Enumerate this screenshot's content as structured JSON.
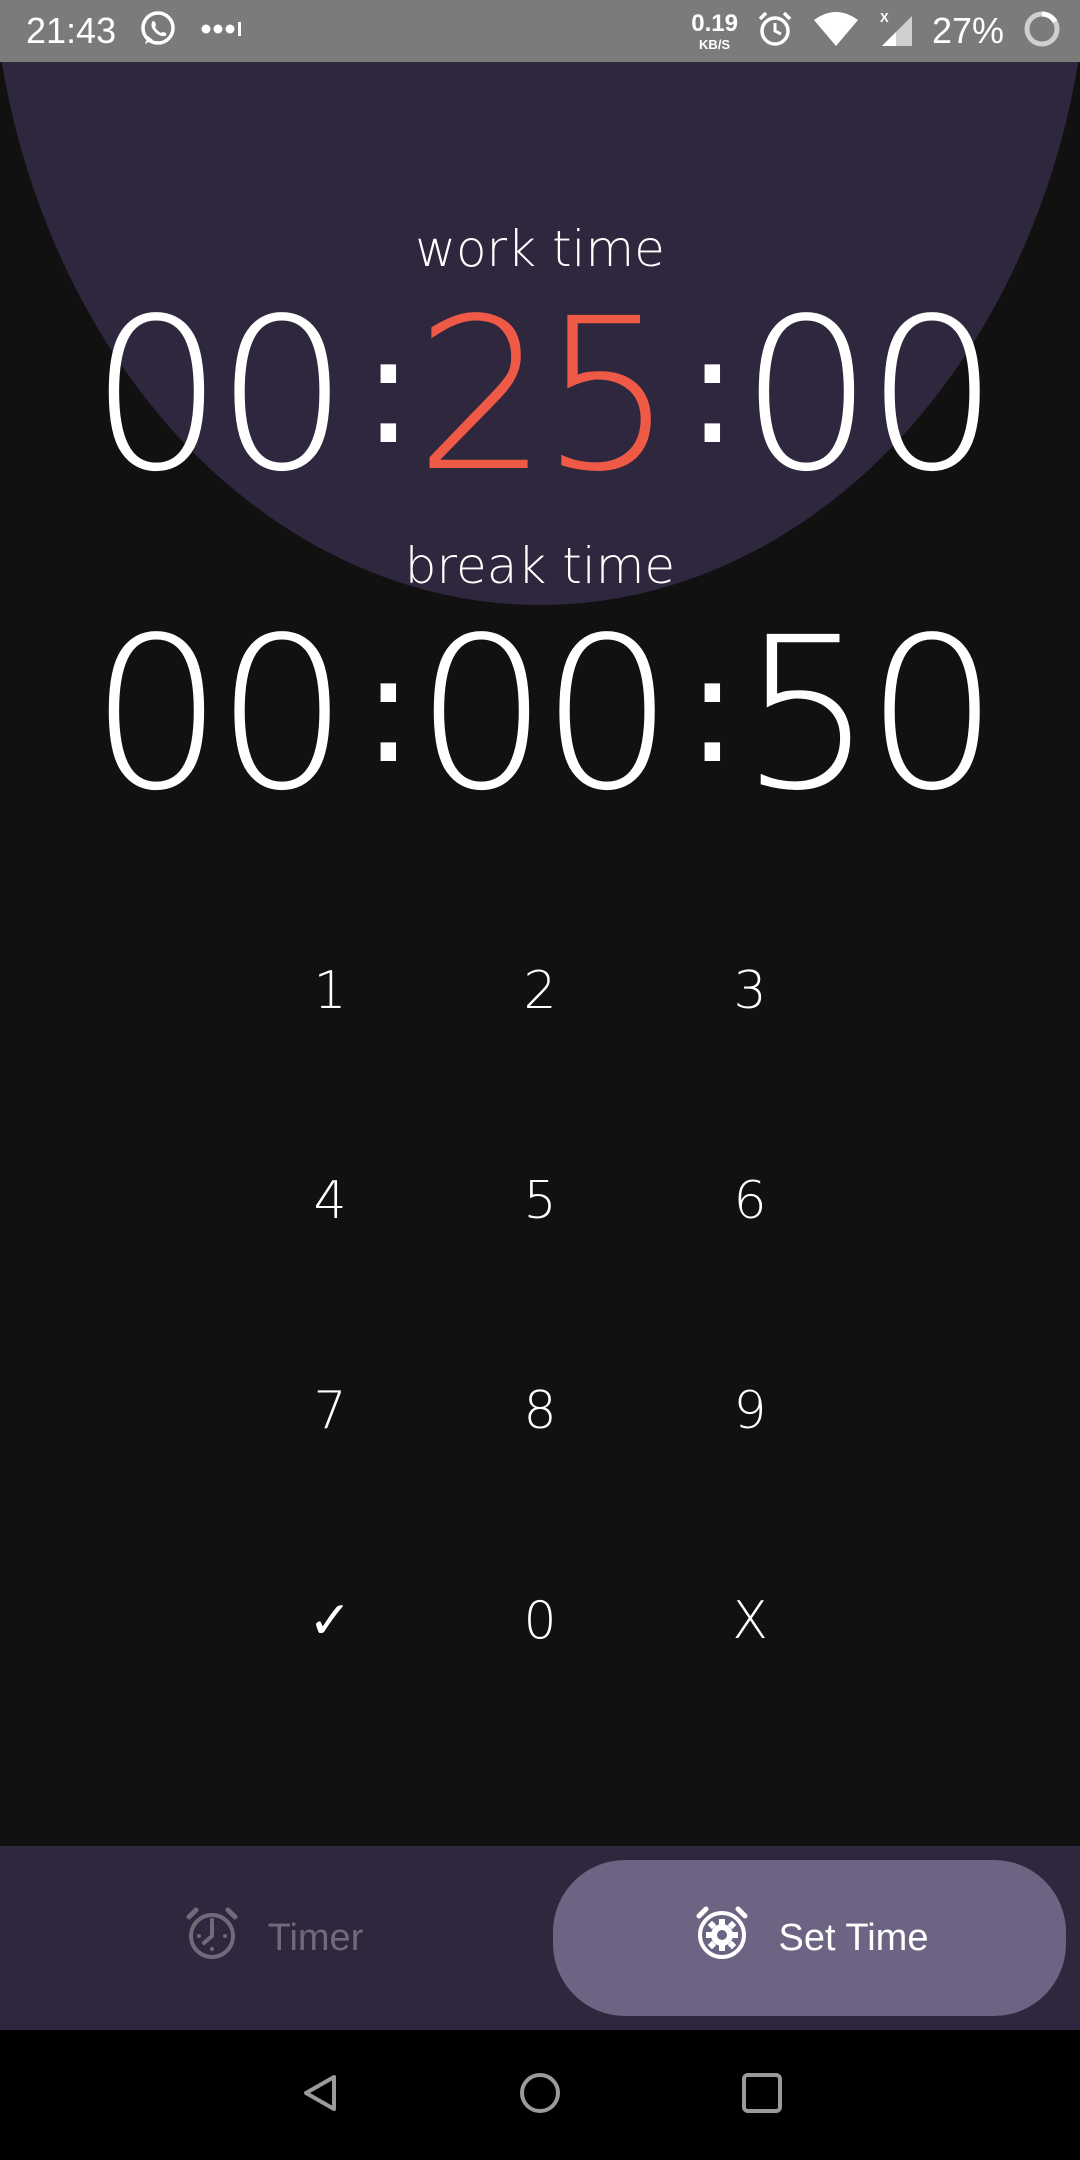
{
  "status_bar": {
    "time": "21:43",
    "net_speed_value": "0.19",
    "net_speed_unit": "KB/S",
    "battery": "27%",
    "icons": [
      "whatsapp-icon",
      "more-notifications-icon",
      "alarm-icon",
      "wifi-icon",
      "signal-icon",
      "battery-ring-icon"
    ]
  },
  "work": {
    "label": "work time",
    "hours": "00",
    "minutes": "25",
    "seconds": "00",
    "active_segment": "minutes"
  },
  "break": {
    "label": "break time",
    "hours": "00",
    "minutes": "00",
    "seconds": "50"
  },
  "keypad": {
    "keys": [
      "1",
      "2",
      "3",
      "4",
      "5",
      "6",
      "7",
      "8",
      "9",
      "✓",
      "0",
      "X"
    ]
  },
  "bottom_nav": {
    "timer_label": "Timer",
    "set_time_label": "Set Time",
    "selected": "Set Time"
  },
  "colors": {
    "background": "#111111",
    "circle": "#2e273d",
    "accent": "#ef5a46",
    "nav_bg": "#2e273d",
    "nav_selected": "#6c6482",
    "nav_inactive_text": "#6f6b78"
  }
}
